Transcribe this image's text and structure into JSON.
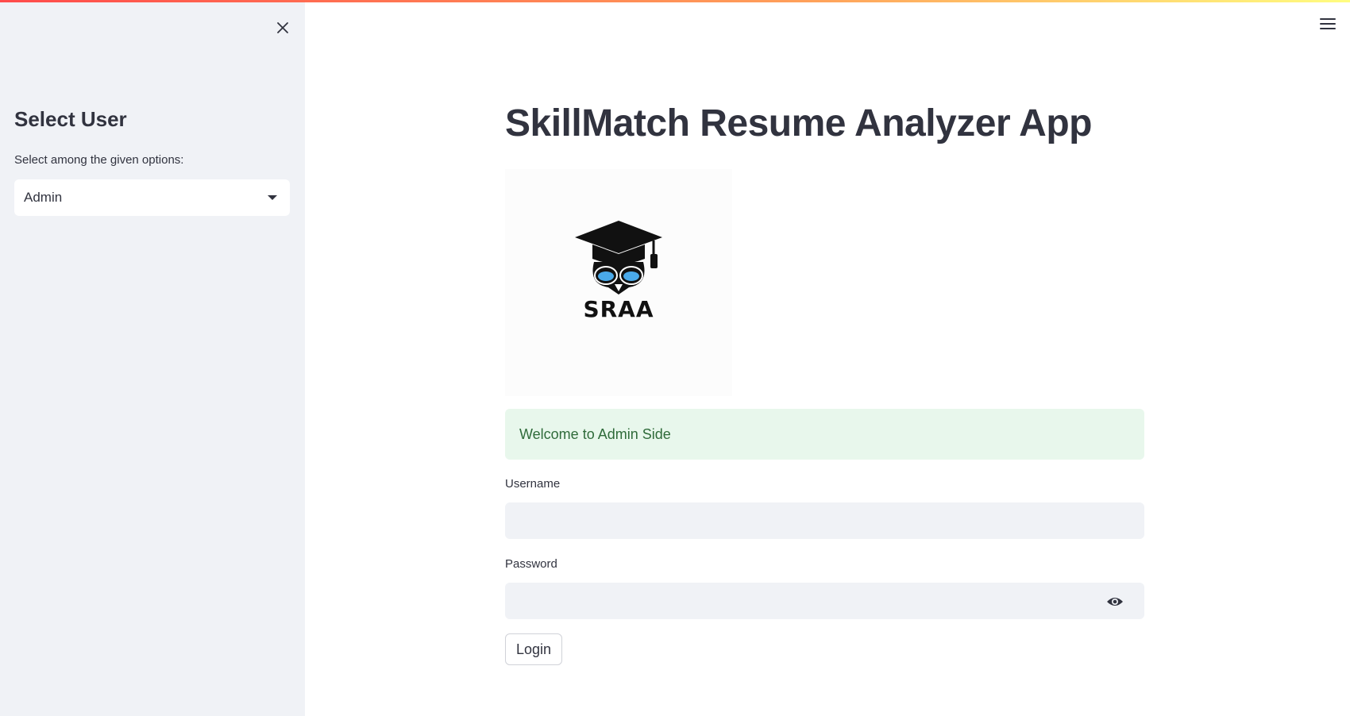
{
  "sidebar": {
    "close_icon": "close-icon",
    "heading": "Select User",
    "help_text": "Select among the given options:",
    "select": {
      "value": "Admin",
      "icon": "chevron-down-icon"
    }
  },
  "header": {
    "menu_icon": "hamburger-menu-icon"
  },
  "main": {
    "title": "SkillMatch Resume Analyzer App",
    "logo": {
      "text": "SRAA",
      "icon": "graduation-owl-logo"
    },
    "success_message": "Welcome to Admin Side",
    "username": {
      "label": "Username",
      "value": ""
    },
    "password": {
      "label": "Password",
      "value": "",
      "toggle_icon": "eye-icon"
    },
    "login_label": "Login"
  },
  "colors": {
    "sidebar_bg": "#f0f2f6",
    "success_bg": "#e8f7ec",
    "success_text": "#2f6b3a",
    "text": "#31333f",
    "accent_gradient_start": "#ff4b4b",
    "accent_gradient_end": "#fffd80"
  }
}
